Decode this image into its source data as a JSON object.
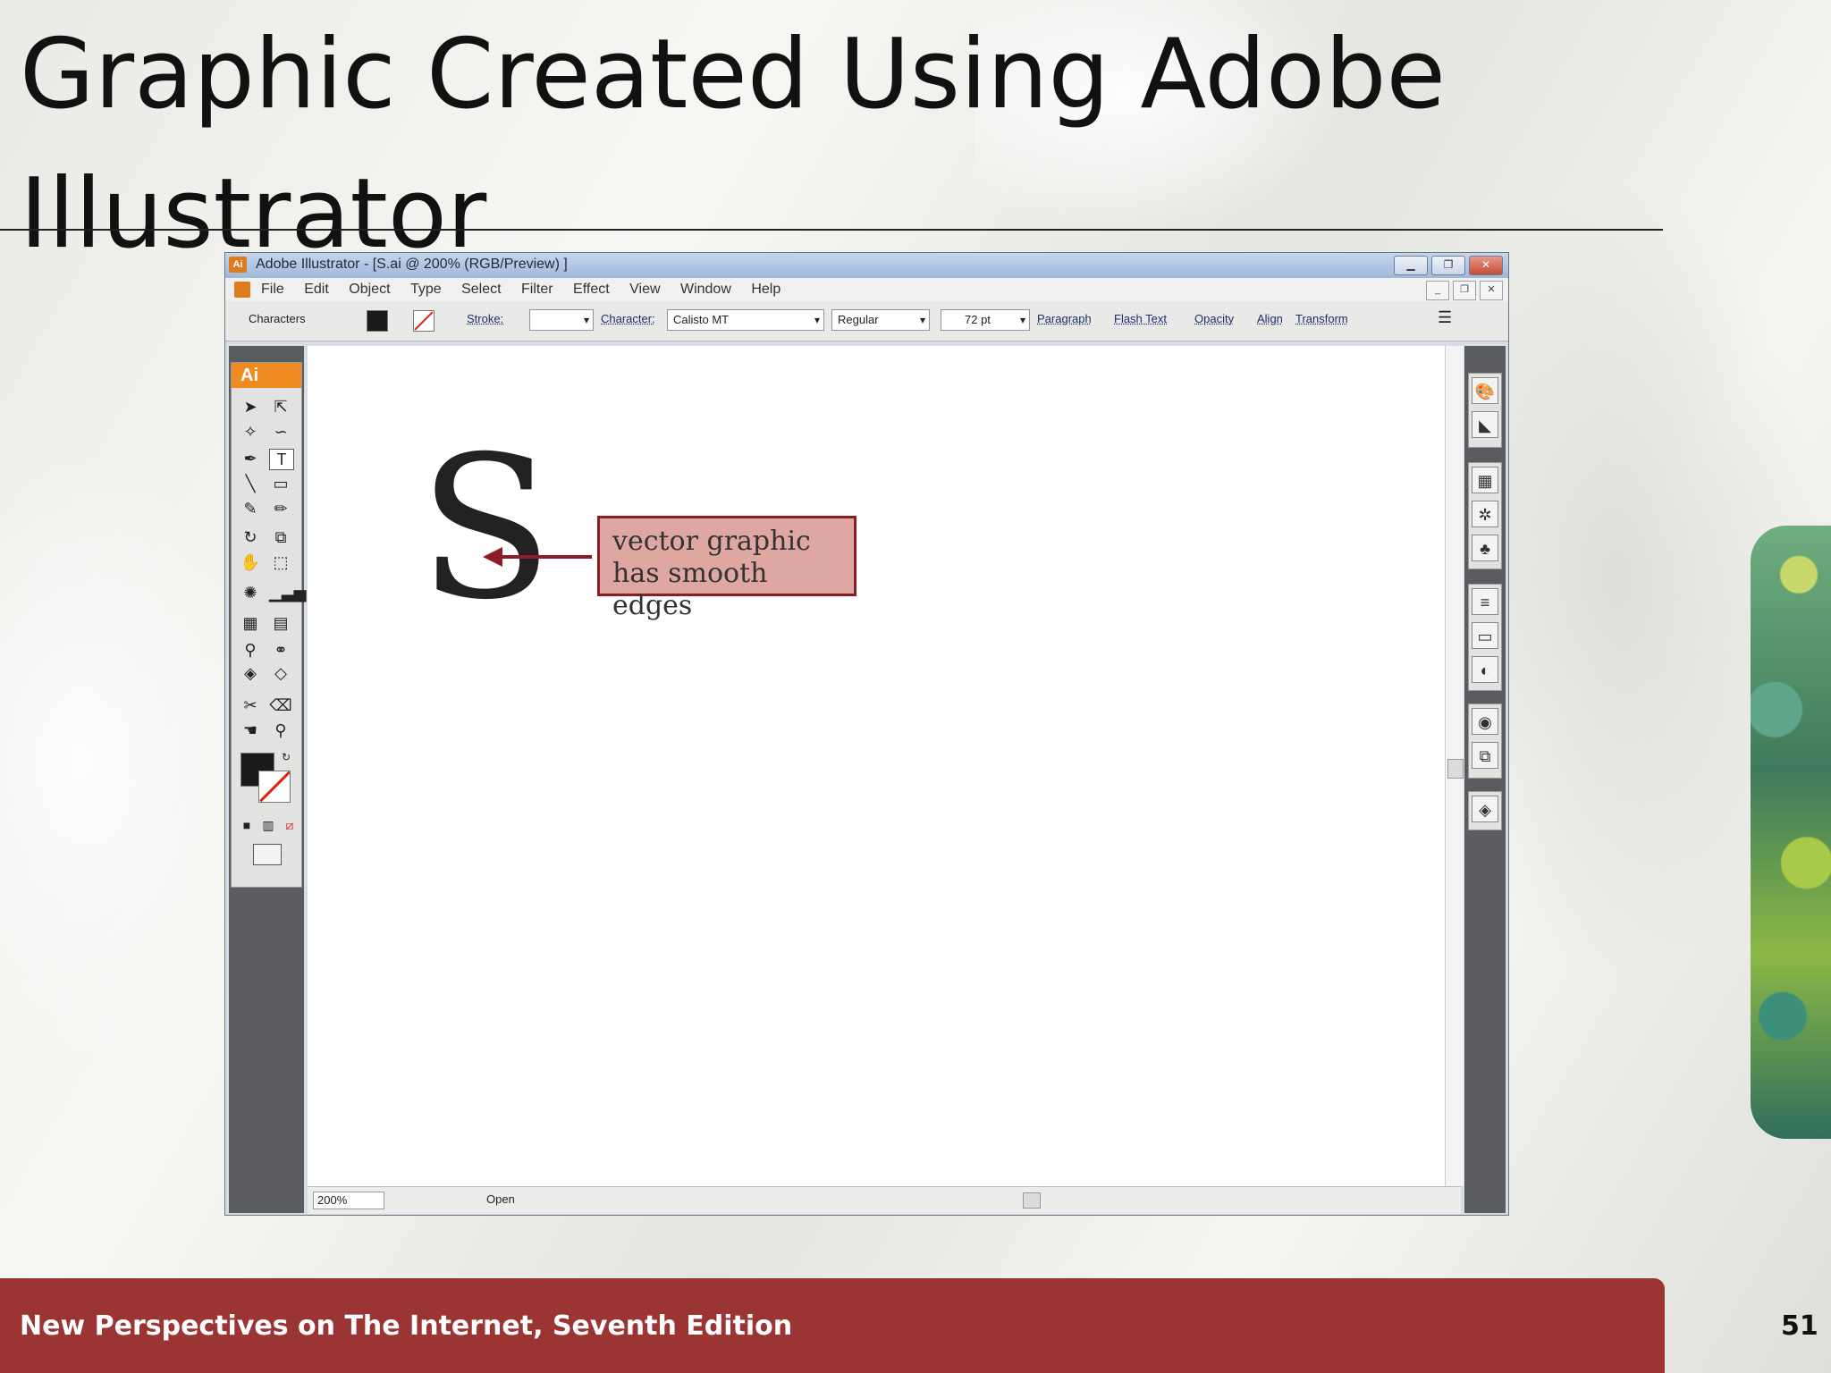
{
  "slide": {
    "title": "Graphic Created Using Adobe Illustrator",
    "footer": "New Perspectives on The Internet, Seventh Edition",
    "page_number": "51"
  },
  "window": {
    "title": "Adobe Illustrator - [S.ai @ 200% (RGB/Preview) ]",
    "menu": [
      "File",
      "Edit",
      "Object",
      "Type",
      "Select",
      "Filter",
      "Effect",
      "View",
      "Window",
      "Help"
    ],
    "control": {
      "mode_label": "Characters",
      "stroke_label": "Stroke:",
      "character_label": "Character:",
      "font_name": "Calisto MT",
      "font_style": "Regular",
      "font_size": "72 pt",
      "links": [
        "Paragraph",
        "Flash Text",
        "Opacity",
        "Align",
        "Transform"
      ]
    },
    "toolbox": {
      "badge": "Ai"
    },
    "canvas": {
      "glyph": "S",
      "callout": "vector graphic has smooth edges"
    },
    "status": {
      "zoom": "200%",
      "text": "Open"
    }
  },
  "colors": {
    "footer_bg": "#9b3533",
    "callout_bg": "#dea7a1",
    "callout_border": "#8b1d28",
    "ai_orange": "#f08a22"
  }
}
